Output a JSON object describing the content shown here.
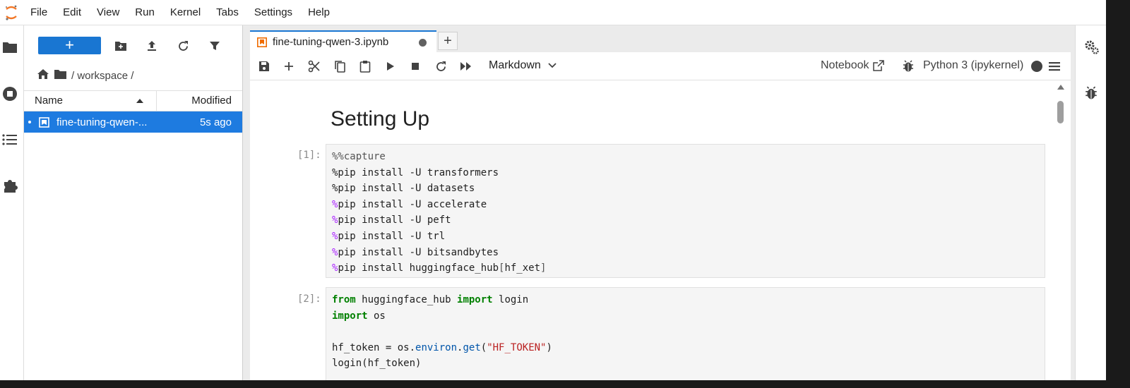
{
  "menu": [
    "File",
    "Edit",
    "View",
    "Run",
    "Kernel",
    "Tabs",
    "Settings",
    "Help"
  ],
  "left_rail": [
    "folder-icon",
    "running-icon",
    "toc-icon",
    "extension-icon"
  ],
  "file_browser": {
    "new_label": "+",
    "breadcrumb": "/ workspace /",
    "columns": {
      "name": "Name",
      "modified": "Modified"
    },
    "rows": [
      {
        "name": "fine-tuning-qwen-...",
        "modified": "5s ago"
      }
    ]
  },
  "tab": {
    "label": "fine-tuning-qwen-3.ipynb",
    "add": "+"
  },
  "notebook_toolbar": {
    "cell_type": "Markdown",
    "notebook_label": "Notebook",
    "kernel": "Python 3 (ipykernel)"
  },
  "notebook": {
    "heading": "Setting Up",
    "cells": [
      {
        "prompt": "[1]:",
        "lines": [
          "%%capture",
          "%pip install -U transformers",
          "%pip install -U datasets",
          "%pip install -U accelerate",
          "%pip install -U peft",
          "%pip install -U trl",
          "%pip install -U bitsandbytes",
          "%pip install huggingface_hub[hf_xet]"
        ]
      },
      {
        "prompt": "[2]:",
        "lines": [
          "from huggingface_hub import login",
          "import os",
          "",
          "hf_token = os.environ.get(\"HF_TOKEN\")",
          "login(hf_token)"
        ]
      }
    ]
  },
  "colors": {
    "accent": "#1976d2",
    "selected_row": "#1e7be0",
    "magic": "#aa22ff",
    "keyword": "#008000",
    "string": "#ba2121"
  }
}
